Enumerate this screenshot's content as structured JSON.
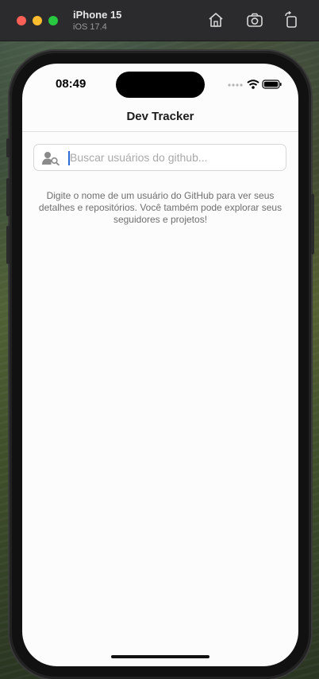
{
  "simulator": {
    "device_name": "iPhone 15",
    "os_version": "iOS 17.4",
    "toolbar": {
      "home_icon": "home-icon",
      "screenshot_icon": "camera-icon",
      "rotate_icon": "rotate-icon"
    }
  },
  "status_bar": {
    "time": "08:49",
    "icons": [
      "cellular-dots-icon",
      "wifi-icon",
      "battery-icon"
    ]
  },
  "app": {
    "nav_title": "Dev Tracker",
    "search": {
      "placeholder": "Buscar usuários do github...",
      "value": "",
      "icon": "user-search-icon"
    },
    "hint_text": "Digite o nome de um usuário do GitHub para ver seus detalhes e repositórios. Você também pode explorar seus seguidores e projetos!"
  },
  "colors": {
    "screen_background": "#fcfcfc",
    "caret": "#2f6bd8",
    "traffic_red": "#fe5f57",
    "traffic_yellow": "#febc2e",
    "traffic_green": "#28c840"
  }
}
